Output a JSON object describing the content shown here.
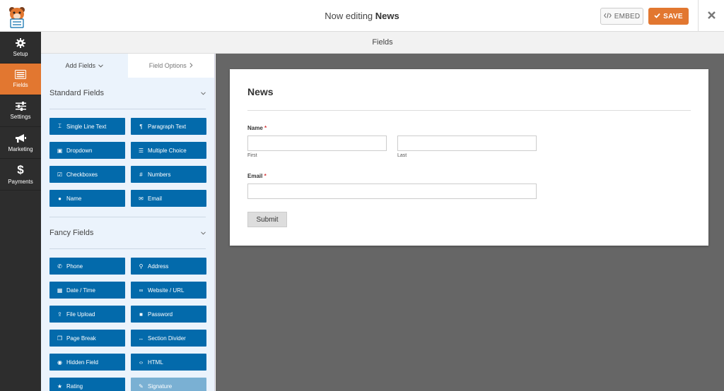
{
  "header": {
    "title_prefix": "Now editing",
    "title_name": "News",
    "embed_label": "EMBED",
    "save_label": "SAVE"
  },
  "nav": {
    "items": [
      {
        "label": "Setup",
        "icon": "gear-icon"
      },
      {
        "label": "Fields",
        "icon": "list-icon",
        "active": true
      },
      {
        "label": "Settings",
        "icon": "sliders-icon"
      },
      {
        "label": "Marketing",
        "icon": "megaphone-icon"
      },
      {
        "label": "Payments",
        "icon": "dollar-icon"
      }
    ]
  },
  "strip": {
    "label": "Fields"
  },
  "panel": {
    "tab_add": "Add Fields",
    "tab_options": "Field Options",
    "standard": {
      "heading": "Standard Fields",
      "buttons": [
        "Single Line Text",
        "Paragraph Text",
        "Dropdown",
        "Multiple Choice",
        "Checkboxes",
        "Numbers",
        "Name",
        "Email"
      ]
    },
    "fancy": {
      "heading": "Fancy Fields",
      "buttons": [
        "Phone",
        "Address",
        "Date / Time",
        "Website / URL",
        "File Upload",
        "Password",
        "Page Break",
        "Section Divider",
        "Hidden Field",
        "HTML",
        "Rating",
        "Signature"
      ]
    }
  },
  "form": {
    "title": "News",
    "name_label": "Name",
    "first_label": "First",
    "last_label": "Last",
    "email_label": "Email",
    "required_mark": "*",
    "submit_label": "Submit"
  },
  "colors": {
    "accent": "#e27730",
    "field_button": "#036aab",
    "sidebar_dark": "#2d2d2d"
  }
}
